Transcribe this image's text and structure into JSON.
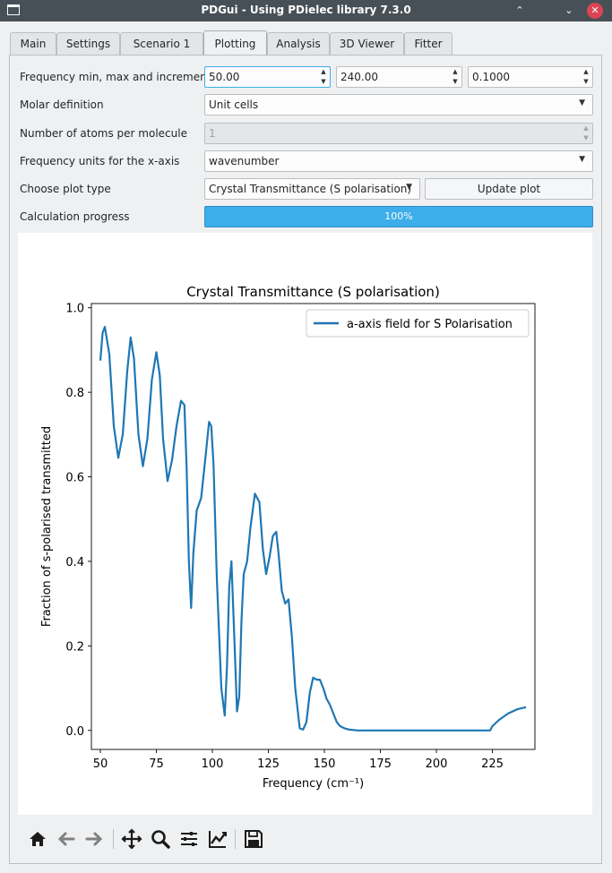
{
  "window": {
    "title": "PDGui - Using PDielec library 7.3.0",
    "minimize": "⌃",
    "maximize": "⌄",
    "close": "✕"
  },
  "tabs": [
    "Main",
    "Settings",
    "Scenario 1",
    "Plotting",
    "Analysis",
    "3D Viewer",
    "Fitter"
  ],
  "active_tab": "Plotting",
  "form": {
    "freq_label": "Frequency min, max and increment",
    "freq_min": "50.00",
    "freq_max": "240.00",
    "freq_inc": "0.1000",
    "molar_label": "Molar definition",
    "molar_value": "Unit cells",
    "atoms_label": "Number of atoms per molecule",
    "atoms_value": "1",
    "units_label": "Frequency units for the x-axis",
    "units_value": "wavenumber",
    "plot_type_label": "Choose plot type",
    "plot_type_value": "Crystal Transmittance (S polarisation)",
    "update_button": "Update plot",
    "progress_label": "Calculation progress",
    "progress_text": "100%",
    "progress_value": 1.0
  },
  "chart_data": {
    "type": "line",
    "title": "Crystal Transmittance (S polarisation)",
    "xlabel": "Frequency (cm⁻¹)",
    "ylabel": "Fraction of s-polarised transmitted",
    "xlim": [
      46,
      244
    ],
    "ylim": [
      -0.045,
      1.01
    ],
    "xticks": [
      50,
      75,
      100,
      125,
      150,
      175,
      200,
      225
    ],
    "yticks": [
      0.0,
      0.2,
      0.4,
      0.6,
      0.8,
      1.0
    ],
    "ytick_labels": [
      "0.0",
      "0.2",
      "0.4",
      "0.6",
      "0.8",
      "1.0"
    ],
    "grid": false,
    "legend": "top-right",
    "series": [
      {
        "name": "a-axis field for S Polarisation",
        "color": "#1f77b4",
        "x": [
          50,
          51,
          52,
          54,
          56,
          58,
          60,
          62,
          63.5,
          65,
          67,
          69,
          71,
          73,
          75,
          76.5,
          78,
          80,
          82,
          84,
          86,
          87.5,
          88.5,
          89.5,
          90.5,
          91.5,
          93,
          95,
          97,
          98.5,
          99.5,
          100.5,
          102,
          104,
          105.5,
          106.5,
          107.5,
          108.5,
          109.8,
          111,
          112,
          113,
          114,
          115.5,
          117,
          119,
          121,
          122.5,
          124,
          125.5,
          127,
          128.5,
          129.5,
          131,
          132.5,
          134,
          135.5,
          137,
          139,
          140.5,
          142,
          143.5,
          145,
          146.5,
          148,
          149.5,
          151,
          152.5,
          154,
          155.5,
          157,
          159,
          161,
          163,
          165,
          168,
          172,
          180,
          200,
          224,
          225,
          228,
          232,
          236,
          240
        ],
        "y": [
          0.875,
          0.94,
          0.955,
          0.89,
          0.72,
          0.645,
          0.7,
          0.85,
          0.93,
          0.88,
          0.7,
          0.625,
          0.69,
          0.83,
          0.895,
          0.84,
          0.69,
          0.59,
          0.64,
          0.72,
          0.78,
          0.77,
          0.62,
          0.4,
          0.29,
          0.42,
          0.52,
          0.55,
          0.65,
          0.73,
          0.72,
          0.63,
          0.36,
          0.1,
          0.035,
          0.15,
          0.34,
          0.4,
          0.22,
          0.045,
          0.08,
          0.26,
          0.37,
          0.4,
          0.48,
          0.56,
          0.54,
          0.43,
          0.37,
          0.41,
          0.46,
          0.47,
          0.42,
          0.33,
          0.3,
          0.31,
          0.22,
          0.1,
          0.005,
          0.002,
          0.02,
          0.09,
          0.125,
          0.12,
          0.12,
          0.1,
          0.075,
          0.06,
          0.04,
          0.02,
          0.01,
          0.005,
          0.002,
          0.001,
          0.0,
          0.0,
          0.0,
          0.0,
          0.0,
          0.0,
          0.01,
          0.025,
          0.04,
          0.05,
          0.055
        ]
      }
    ]
  },
  "toolbar": {
    "home": "home-icon",
    "back": "back-arrow-icon",
    "forward": "forward-arrow-icon",
    "pan": "pan-icon",
    "zoom": "zoom-icon",
    "subplots": "subplots-icon",
    "customize": "customize-icon",
    "save": "save-icon"
  }
}
